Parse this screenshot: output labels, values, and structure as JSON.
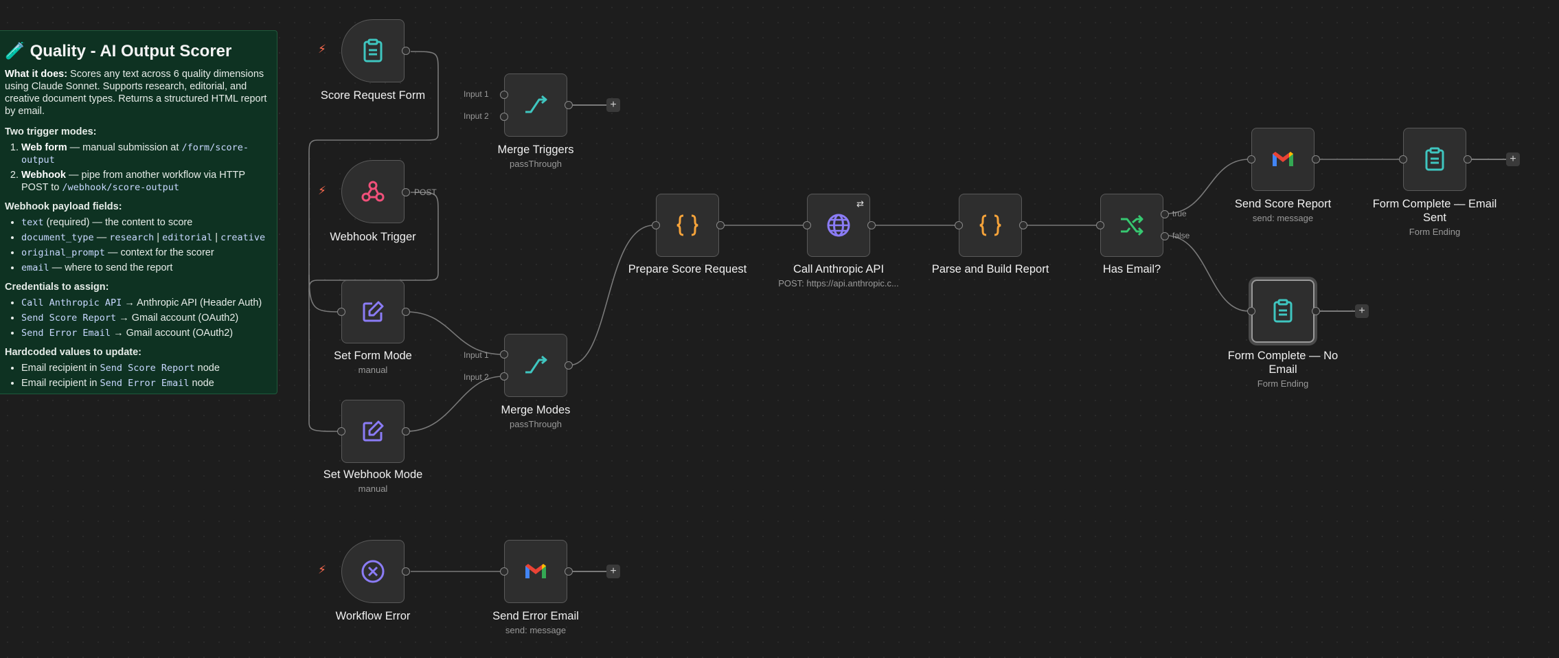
{
  "sticky": {
    "title_icon": "🧪",
    "title": "Quality - AI Output Scorer",
    "what_label": "What it does:",
    "what_text": " Scores any text across 6 quality dimensions using Claude Sonnet. Supports research, editorial, and creative document types. Returns a structured HTML report by email.",
    "modes_heading": "Two trigger modes:",
    "mode1_bold": "Web form",
    "mode1_text": " — manual submission at ",
    "mode1_code": "/form/score-output",
    "mode2_bold": "Webhook",
    "mode2_text": " — pipe from another workflow via HTTP POST to ",
    "mode2_code": "/webhook/score-output",
    "payload_heading": "Webhook payload fields:",
    "f1_code": "text",
    "f1_text": " (required) — the content to score",
    "f2_code": "document_type",
    "f2_sep": " — ",
    "f2_v1": "research",
    "f2_v2": "editorial",
    "f2_v3": "creative",
    "f2_bar": " | ",
    "f3_code": "original_prompt",
    "f3_text": " — context for the scorer",
    "f4_code": "email",
    "f4_text": " — where to send the report",
    "cred_heading": "Credentials to assign:",
    "c1_code": "Call Anthropic API",
    "c1_text": " → Anthropic API (Header Auth)",
    "c2_code": "Send Score Report",
    "c2_text": " → Gmail account (OAuth2)",
    "c3_code": "Send Error Email",
    "c3_text": " → Gmail account (OAuth2)",
    "hard_heading": "Hardcoded values to update:",
    "h1_text": "Email recipient in ",
    "h1_code": "Send Score Report",
    "h1_tail": " node",
    "h2_text": "Email recipient in ",
    "h2_code": "Send Error Email",
    "h2_tail": " node"
  },
  "nodes": {
    "score_request_form": {
      "label": "Score Request Form",
      "icon": "clipboard-icon"
    },
    "webhook_trigger": {
      "label": "Webhook Trigger",
      "icon": "webhook-icon",
      "port_label": "POST"
    },
    "set_form_mode": {
      "label": "Set Form Mode",
      "sub": "manual",
      "icon": "edit-icon"
    },
    "set_webhook_mode": {
      "label": "Set Webhook Mode",
      "sub": "manual",
      "icon": "edit-icon"
    },
    "merge_triggers": {
      "label": "Merge Triggers",
      "sub": "passThrough",
      "input1": "Input 1",
      "input2": "Input 2",
      "icon": "merge-icon"
    },
    "merge_modes": {
      "label": "Merge Modes",
      "sub": "passThrough",
      "input1": "Input 1",
      "input2": "Input 2",
      "icon": "merge-icon"
    },
    "prepare_score_request": {
      "label": "Prepare Score Request",
      "icon": "code-braces-icon"
    },
    "call_anthropic_api": {
      "label": "Call Anthropic API",
      "sub": "POST: https://api.anthropic.c...",
      "icon": "globe-icon",
      "badge": "⇄"
    },
    "parse_and_build_report": {
      "label": "Parse and Build Report",
      "icon": "code-braces-icon"
    },
    "has_email": {
      "label": "Has Email?",
      "true_label": "true",
      "false_label": "false",
      "icon": "if-icon"
    },
    "send_score_report": {
      "label": "Send Score Report",
      "sub": "send: message",
      "icon": "gmail-icon"
    },
    "form_complete_sent": {
      "label": "Form Complete — Email Sent",
      "sub": "Form Ending",
      "icon": "clipboard-icon"
    },
    "form_complete_no_email": {
      "label": "Form Complete — No Email",
      "sub": "Form Ending",
      "icon": "clipboard-icon"
    },
    "workflow_error": {
      "label": "Workflow Error",
      "icon": "error-icon"
    },
    "send_error_email": {
      "label": "Send Error Email",
      "sub": "send: message",
      "icon": "gmail-icon"
    }
  },
  "ui": {
    "plus": "+",
    "bolt": "⚡"
  },
  "colors": {
    "canvas": "#1d1d1d",
    "sticky": "#0e3222",
    "node": "#2e2e2e",
    "teal": "#3fc6c0",
    "purple": "#8b7cf6",
    "orange": "#f6a33a",
    "green": "#37c871",
    "pink": "#f0507a"
  }
}
